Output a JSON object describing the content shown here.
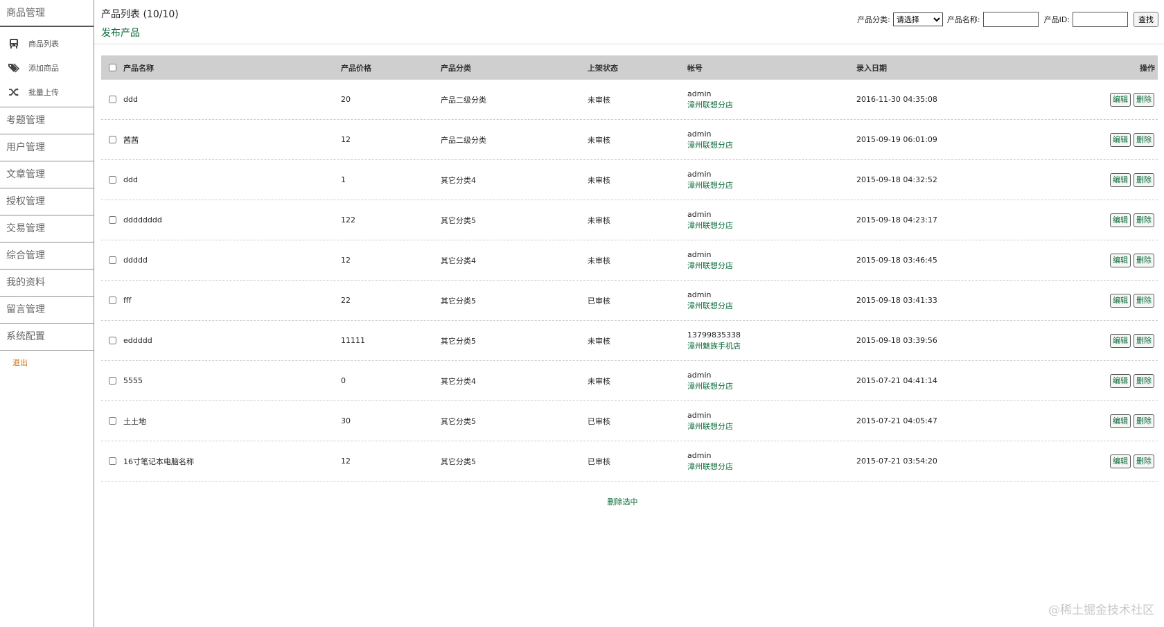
{
  "sidebar": {
    "sections_top": {
      "label": "商品管理"
    },
    "sub_items": [
      {
        "label": "商品列表",
        "icon": "bus-icon"
      },
      {
        "label": "添加商品",
        "icon": "tags-icon"
      },
      {
        "label": "批量上传",
        "icon": "shuffle-icon"
      }
    ],
    "sections": [
      {
        "label": "考题管理"
      },
      {
        "label": "用户管理"
      },
      {
        "label": "文章管理"
      },
      {
        "label": "授权管理"
      },
      {
        "label": "交易管理"
      },
      {
        "label": "综合管理"
      },
      {
        "label": "我的资料"
      },
      {
        "label": "留言管理"
      },
      {
        "label": "系统配置"
      }
    ],
    "logout": "退出"
  },
  "header": {
    "title": "产品列表 (10/10)",
    "publish": "发布产品",
    "filter": {
      "category_label": "产品分类:",
      "category_value": "请选择",
      "name_label": "产品名称:",
      "id_label": "产品ID:",
      "search_button": "查找"
    }
  },
  "table": {
    "columns": [
      "产品名称",
      "产品价格",
      "产品分类",
      "上架状态",
      "帐号",
      "录入日期",
      "操作"
    ],
    "rows": [
      {
        "name": "ddd",
        "price": "20",
        "category": "产品二级分类",
        "status": "未审核",
        "user": "admin",
        "shop": "漳州联想分店",
        "date": "2016-11-30 04:35:08"
      },
      {
        "name": "茜茜",
        "price": "12",
        "category": "产品二级分类",
        "status": "未审核",
        "user": "admin",
        "shop": "漳州联想分店",
        "date": "2015-09-19 06:01:09"
      },
      {
        "name": "ddd",
        "price": "1",
        "category": "其它分类4",
        "status": "未审核",
        "user": "admin",
        "shop": "漳州联想分店",
        "date": "2015-09-18 04:32:52"
      },
      {
        "name": "dddddddd",
        "price": "122",
        "category": "其它分类5",
        "status": "未审核",
        "user": "admin",
        "shop": "漳州联想分店",
        "date": "2015-09-18 04:23:17"
      },
      {
        "name": "ddddd",
        "price": "12",
        "category": "其它分类4",
        "status": "未审核",
        "user": "admin",
        "shop": "漳州联想分店",
        "date": "2015-09-18 03:46:45"
      },
      {
        "name": "fff",
        "price": "22",
        "category": "其它分类5",
        "status": "已审核",
        "user": "admin",
        "shop": "漳州联想分店",
        "date": "2015-09-18 03:41:33"
      },
      {
        "name": "eddddd",
        "price": "11111",
        "category": "其它分类5",
        "status": "未审核",
        "user": "13799835338",
        "shop": "漳州魅族手机店",
        "date": "2015-09-18 03:39:56"
      },
      {
        "name": "5555",
        "price": "0",
        "category": "其它分类4",
        "status": "未审核",
        "user": "admin",
        "shop": "漳州联想分店",
        "date": "2015-07-21 04:41:14"
      },
      {
        "name": "土土地",
        "price": "30",
        "category": "其它分类5",
        "status": "已审核",
        "user": "admin",
        "shop": "漳州联想分店",
        "date": "2015-07-21 04:05:47"
      },
      {
        "name": "16寸笔记本电脑名称",
        "price": "12",
        "category": "其它分类5",
        "status": "已审核",
        "user": "admin",
        "shop": "漳州联想分店",
        "date": "2015-07-21 03:54:20"
      }
    ],
    "edit_label": "编辑",
    "delete_label": "删除",
    "delete_selected": "删除选中"
  },
  "watermark": "@稀土掘金技术社区",
  "colors": {
    "accent": "#0a6b3a",
    "logout": "#d46d00",
    "header_bg": "#cfcfcf"
  }
}
